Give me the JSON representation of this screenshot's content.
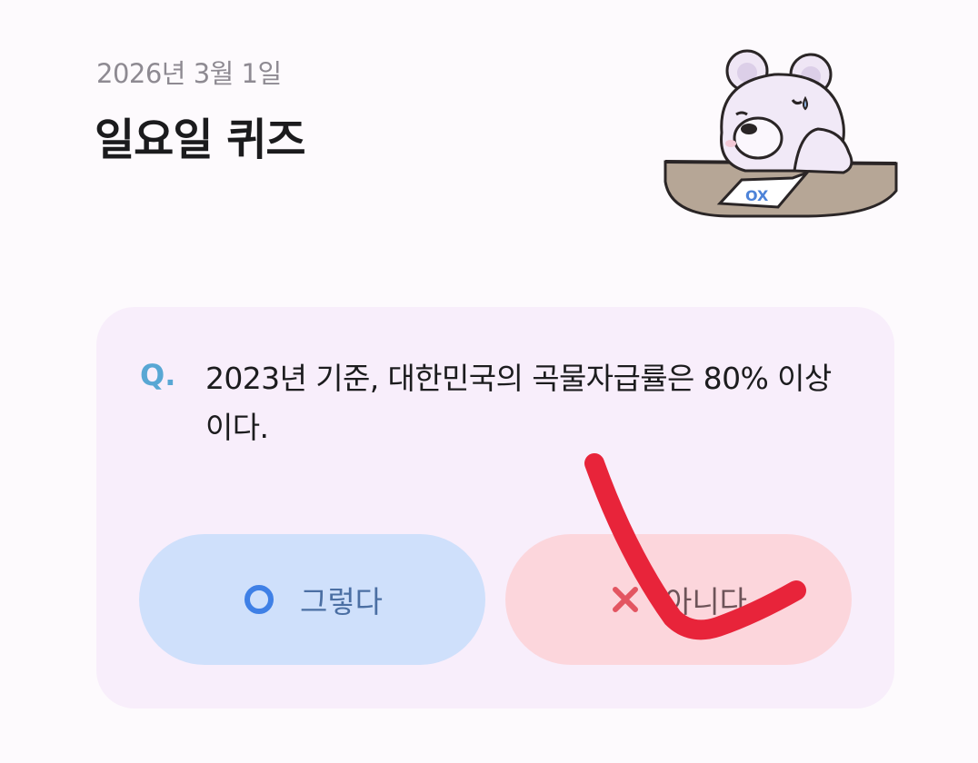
{
  "header": {
    "date": "2026년 3월 1일",
    "title": "일요일 퀴즈"
  },
  "mascot": {
    "icon": "bear-mascot-icon",
    "paper_text": "OX"
  },
  "quiz": {
    "q_mark": "Q.",
    "question": "2023년 기준, 대한민국의 곡물자급률은 80% 이상이다."
  },
  "answers": {
    "yes": {
      "icon": "circle-o-icon",
      "label": "그렇다",
      "color": "#3f80e6"
    },
    "no": {
      "icon": "x-icon",
      "label": "아니다",
      "color": "#e35561"
    }
  },
  "colors": {
    "card_bg": "#f8eefb",
    "yes_bg": "#cfe0fb",
    "no_bg": "#fcd6dc",
    "scribble": "#e8243a"
  }
}
